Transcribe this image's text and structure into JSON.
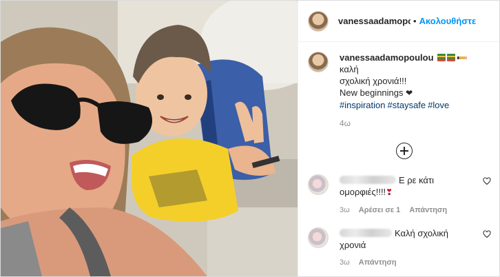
{
  "header": {
    "username": "vanessaadamopou",
    "separator": "•",
    "follow_label": "Ακολουθήστε"
  },
  "caption": {
    "username": "vanessaadamopoulou",
    "text_line1": "καλή",
    "text_line2": "σχολική χρονιά!!!",
    "text_line3": "New beginnings",
    "hashtags": [
      "#inspiration",
      "#staysafe",
      "#love"
    ],
    "time": "4ω"
  },
  "comments": [
    {
      "text_line1": "Ε ρε κάτι",
      "text_line2": "ομορφιές!!!!",
      "time": "3ω",
      "likes_label": "Αρέσει σε 1",
      "reply_label": "Απάντηση"
    },
    {
      "text_line1": "Καλή σχολική",
      "text_line2": "χρονιά",
      "time": "3ω",
      "reply_label": "Απάντηση"
    }
  ],
  "icons": {
    "load_more": "plus-circle-icon",
    "like": "heart-outline-icon"
  },
  "colors": {
    "accent": "#0095f6",
    "hashtag": "#00376b",
    "muted": "#8e8e8e"
  }
}
